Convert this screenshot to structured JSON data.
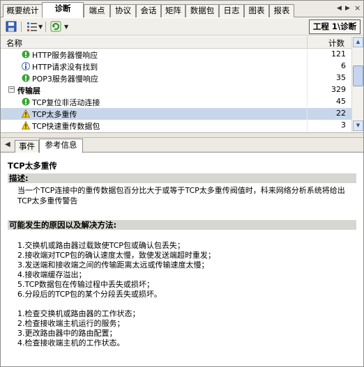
{
  "tabs": [
    "概要统计",
    "诊断",
    "端点",
    "协议",
    "会话",
    "矩阵",
    "数据包",
    "日志",
    "图表",
    "报表"
  ],
  "tab_nav": [
    "◀",
    "▶",
    "×"
  ],
  "toolbar": {
    "project_label": "工程 1\\诊断"
  },
  "table": {
    "columns": {
      "name": "名称",
      "count": "计数"
    },
    "rows": [
      {
        "name": "HTTP服务器慢响应",
        "count": "121",
        "icon": "green-circle-icon"
      },
      {
        "name": "HTTP请求没有找到",
        "count": "6",
        "icon": "info-icon"
      },
      {
        "name": "POP3服务器慢响应",
        "count": "35",
        "icon": "green-circle-icon"
      },
      {
        "name": "传输层",
        "count": "329",
        "icon": "expander"
      },
      {
        "name": "TCP复位非活动连接",
        "count": "45",
        "icon": "green-circle-icon"
      },
      {
        "name": "TCP太多重传",
        "count": "22",
        "icon": "warning-icon"
      },
      {
        "name": "TCP快速重传数据包",
        "count": "3",
        "icon": "warning-icon"
      }
    ]
  },
  "bottom_tabs": [
    "事件",
    "参考信息"
  ],
  "info": {
    "title": "TCP太多重传",
    "desc_head": "描述:",
    "desc_text": "当一个TCP连接中的重传数据包百分比大于或等于TCP太多重传阀值时，科来网络分析系统将给出TCP太多重传警告",
    "causes_head": "可能发生的原因以及解决方法:",
    "causes": [
      "1.交换机或路由器过载致使TCP包或确认包丢失；",
      "2.接收端对TCP包的确认速度太慢，致使发送端超时重发；",
      "3.发送端和接收端之间的传输距离太远或传输速度太慢；",
      "4.接收端缓存溢出；",
      "5.TCP数据包在传输过程中丢失或损坏；",
      "6.分段后的TCP包的某个分段丢失或损坏。"
    ],
    "solutions": [
      "1.检查交换机或路由器的工作状态；",
      "2.检查接收端主机运行的服务；",
      "3.更改路由器中的路由配置；",
      "4.检查接收端主机的工作状态。"
    ]
  }
}
